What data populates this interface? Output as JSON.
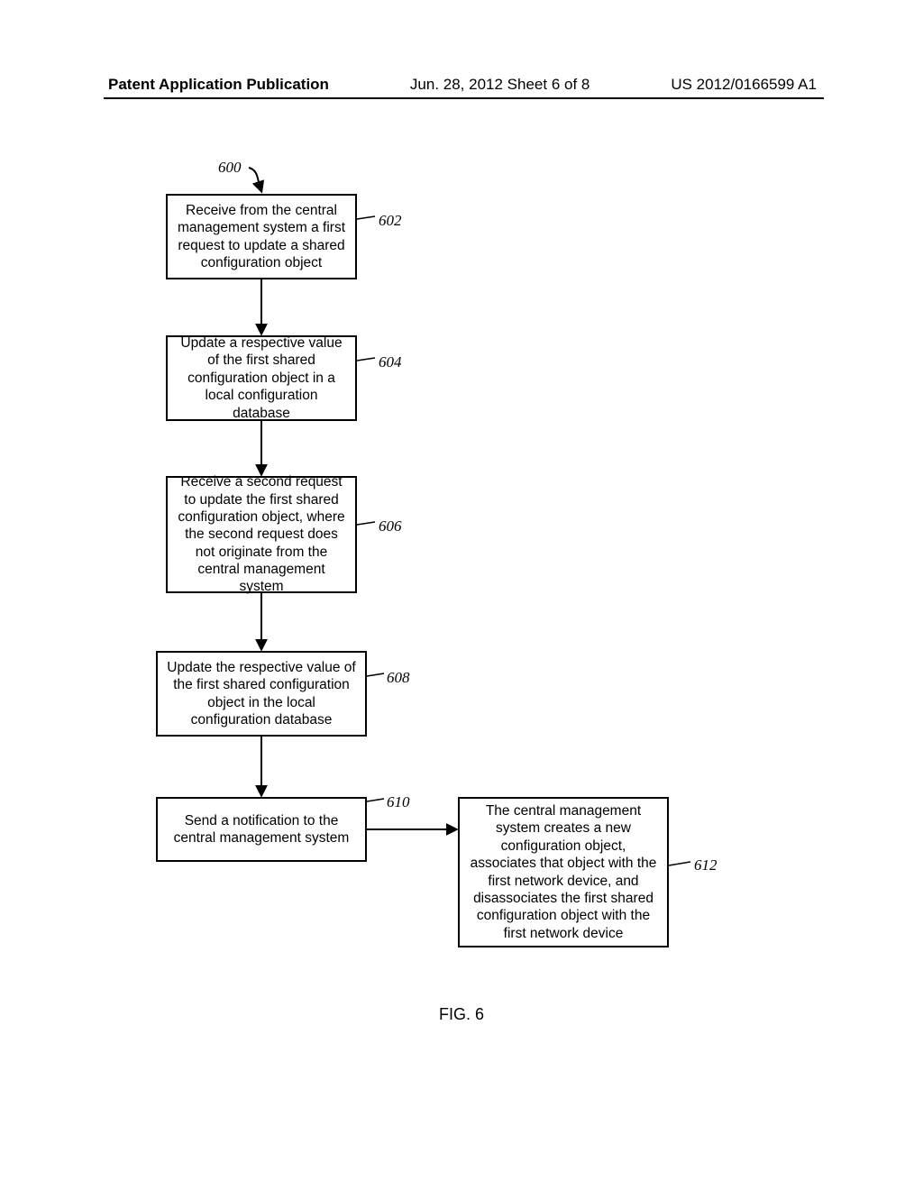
{
  "header": {
    "left": "Patent Application Publication",
    "center": "Jun. 28, 2012  Sheet 6 of 8",
    "right": "US 2012/0166599 A1"
  },
  "labels": {
    "l600": "600",
    "l602": "602",
    "l604": "604",
    "l606": "606",
    "l608": "608",
    "l610": "610",
    "l612": "612"
  },
  "boxes": {
    "b602": "Receive from the central management system a first request to update a shared configuration object",
    "b604": "Update a respective value of the first shared configuration object in a local configuration database",
    "b606": "Receive a second request to update the first shared configuration object, where the second request does not originate from the central management system",
    "b608": "Update the respective value of the first shared configuration object in the local configuration database",
    "b610": "Send a notification to the central management system",
    "b612": "The central management system creates a new configuration object, associates that object with the first network device, and disassociates the first shared configuration object with the first network device"
  },
  "figure_caption": "FIG. 6"
}
